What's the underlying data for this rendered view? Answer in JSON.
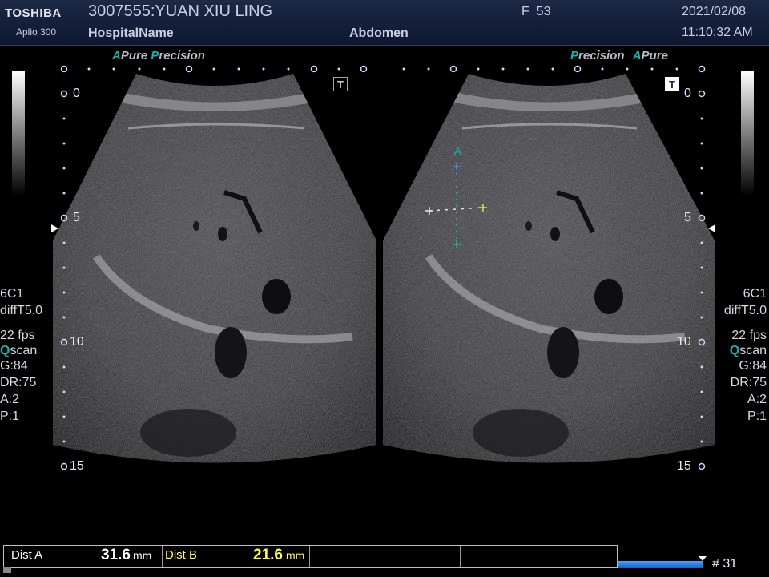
{
  "header": {
    "brand": "TOSHIBA",
    "model": "Aplio 300",
    "patient": "3007555:YUAN XIU LING",
    "hospital": "HospitalName",
    "sex_age": "F  53",
    "preset": "Abdomen",
    "date": "2021/02/08",
    "time": "11:10:32 AM"
  },
  "logos": {
    "left": {
      "a": "A",
      "pure": "Pure ",
      "p": "P",
      "recision": "recision"
    },
    "right": {
      "p": "P",
      "recision": "recision",
      "a": "A",
      "pure": "Pure"
    }
  },
  "depth_labels": [
    "0",
    "5",
    "10",
    "15"
  ],
  "params": {
    "probe": "6C1",
    "mode": "diffT5.0",
    "fps": "22 fps",
    "scan_q": "Q",
    "scan_rest": "scan",
    "gain": "G:84",
    "dr": "DR:75",
    "a": "A:2",
    "p": "P:1"
  },
  "caliper": {
    "label": "A"
  },
  "measurements": [
    {
      "label": "Dist A",
      "value": "31.6",
      "unit": "mm",
      "color": "#ffffff"
    },
    {
      "label": "Dist B",
      "value": "21.6",
      "unit": "mm",
      "color": "#ffff55"
    }
  ],
  "frame_number": "# 31",
  "progress_fraction": 1.0,
  "colors": {
    "accent": "#1cb0b0",
    "caliper_a": "#1cb0b0",
    "caliper_b": "#e8e8e8",
    "dist_b": "#ffff55"
  }
}
